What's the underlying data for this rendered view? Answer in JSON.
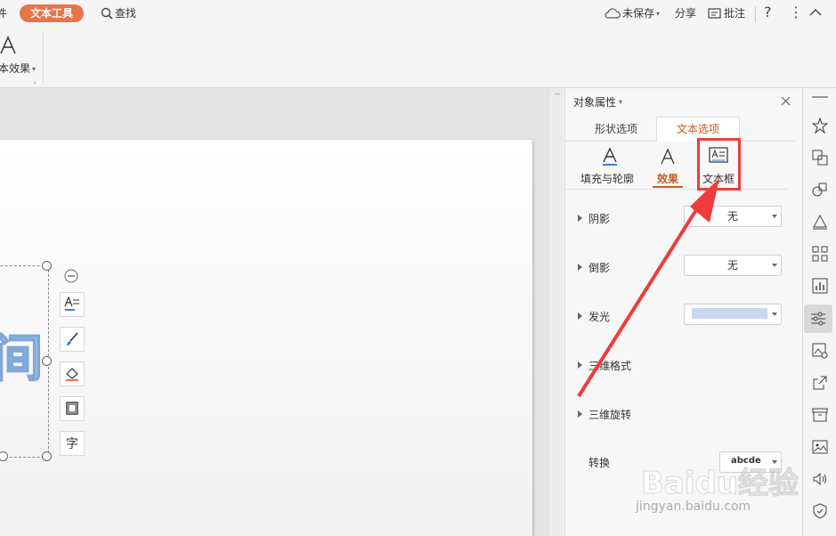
{
  "topbar": {
    "left_partial": "件",
    "tab_active": "文本工具",
    "search_label": "查找",
    "unsaved_label": "未保存",
    "share_label": "分享",
    "comment_label": "批注",
    "help_label": "?"
  },
  "ribbon": {
    "effect_label": "本效果"
  },
  "canvas": {
    "big_char": "间"
  },
  "panel": {
    "title": "对象属性",
    "tabs": [
      "形状选项",
      "文本选项"
    ],
    "subtabs": [
      "填充与轮廓",
      "效果",
      "文本框"
    ],
    "rows": [
      {
        "label": "阴影",
        "value": "无"
      },
      {
        "label": "倒影",
        "value": "无"
      },
      {
        "label": "发光",
        "value": ""
      },
      {
        "label": "三维格式",
        "value": ""
      },
      {
        "label": "三维旋转",
        "value": ""
      },
      {
        "label": "转换",
        "value": "abcde"
      }
    ],
    "glow_color": "#c9d8f0"
  },
  "colors": {
    "accent": "#e8744a",
    "annotation_red": "#ef3b3b",
    "active_tab_text": "#c85a1a"
  },
  "watermark": {
    "brand": "Baidu经验",
    "url": "jingyan.baidu.com"
  }
}
